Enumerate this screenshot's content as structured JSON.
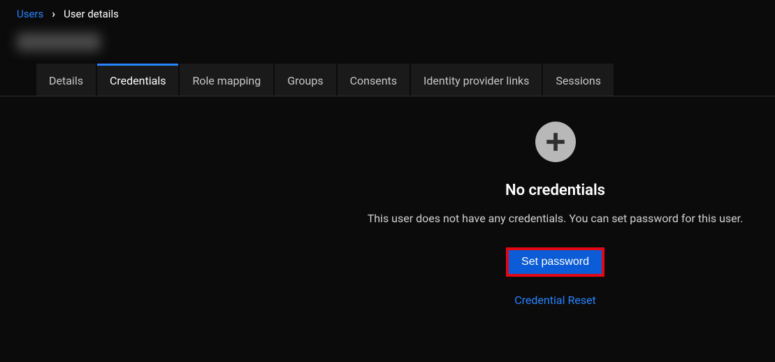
{
  "breadcrumb": {
    "parent": "Users",
    "current": "User details"
  },
  "tabs": [
    {
      "label": "Details",
      "active": false
    },
    {
      "label": "Credentials",
      "active": true
    },
    {
      "label": "Role mapping",
      "active": false
    },
    {
      "label": "Groups",
      "active": false
    },
    {
      "label": "Consents",
      "active": false
    },
    {
      "label": "Identity provider links",
      "active": false
    },
    {
      "label": "Sessions",
      "active": false
    }
  ],
  "empty_state": {
    "title": "No credentials",
    "description": "This user does not have any credentials. You can set password for this user.",
    "primary_action": "Set password",
    "secondary_action": "Credential Reset"
  }
}
